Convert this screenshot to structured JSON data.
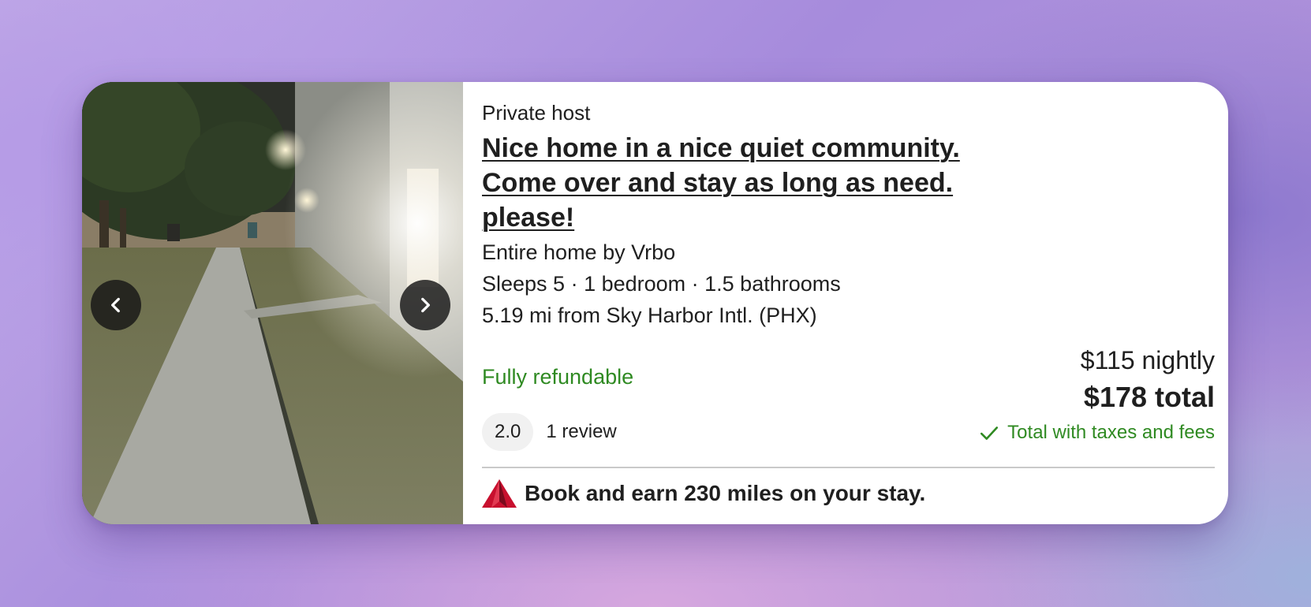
{
  "listing": {
    "host_type": "Private host",
    "title": "Nice home in a nice quiet community. Come over and stay as long as need. please!",
    "property_type": "Entire home by Vrbo",
    "details": "Sleeps 5 · 1 bedroom · 1.5 bathrooms",
    "distance": "5.19 mi from Sky Harbor Intl. (PHX)",
    "refund_policy": "Fully refundable",
    "rating": "2.0",
    "review_count": "1 review"
  },
  "pricing": {
    "nightly": "$115 nightly",
    "total": "$178 total",
    "taxes_note": "Total with taxes and fees"
  },
  "promo": {
    "text": "Book and earn 230 miles on your stay.",
    "icon": "delta-logo-icon"
  },
  "carousel": {
    "prev_icon": "chevron-left-icon",
    "next_icon": "chevron-right-icon"
  },
  "colors": {
    "accent_green": "#2f8a22",
    "text": "#1f1f1f",
    "card_bg": "#ffffff",
    "brand_red": "#c8102e"
  }
}
